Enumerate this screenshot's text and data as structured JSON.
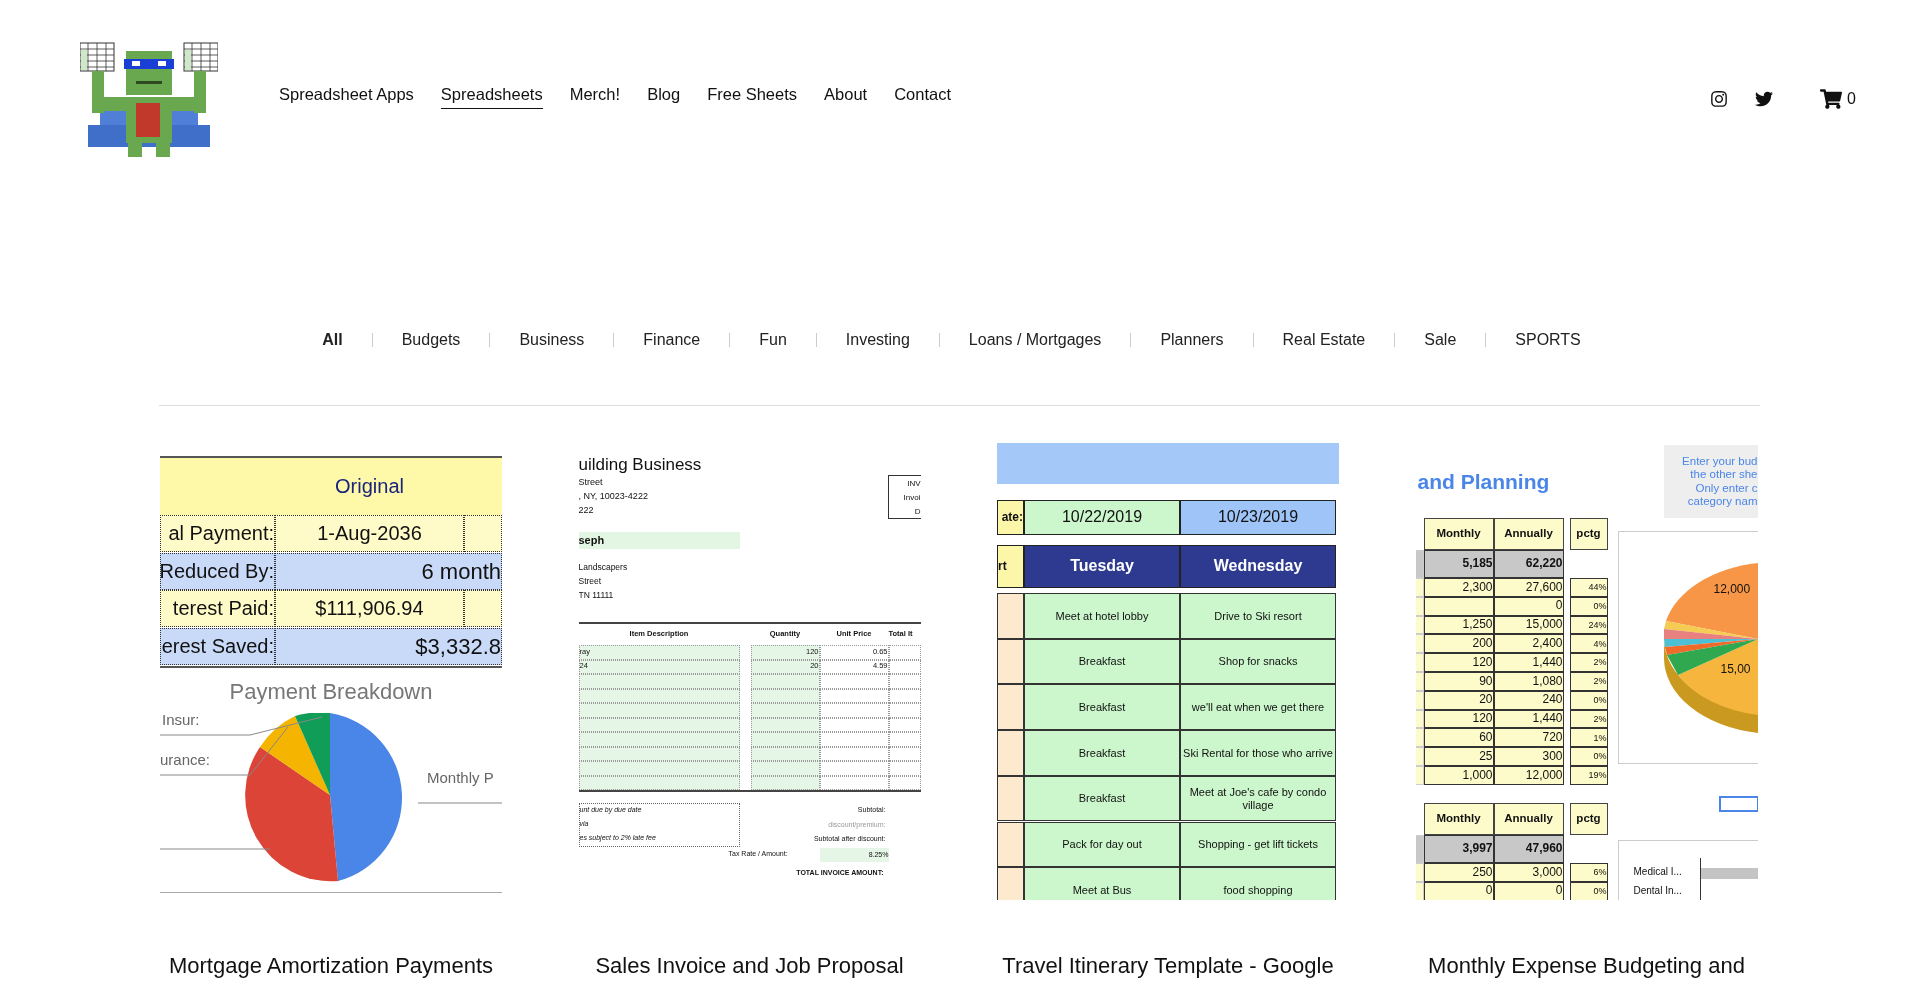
{
  "nav": {
    "items": [
      {
        "label": "Spreadsheet Apps",
        "selected": false
      },
      {
        "label": "Spreadsheets",
        "selected": true
      },
      {
        "label": "Merch!",
        "selected": false
      },
      {
        "label": "Blog",
        "selected": false
      },
      {
        "label": "Free Sheets",
        "selected": false
      },
      {
        "label": "About",
        "selected": false
      },
      {
        "label": "Contact",
        "selected": false
      }
    ],
    "cart_count": "0"
  },
  "filters": [
    {
      "label": "All",
      "selected": true
    },
    {
      "label": "Budgets",
      "selected": false
    },
    {
      "label": "Business",
      "selected": false
    },
    {
      "label": "Finance",
      "selected": false
    },
    {
      "label": "Fun",
      "selected": false
    },
    {
      "label": "Investing",
      "selected": false
    },
    {
      "label": "Loans / Mortgages",
      "selected": false
    },
    {
      "label": "Planners",
      "selected": false
    },
    {
      "label": "Real Estate",
      "selected": false
    },
    {
      "label": "Sale",
      "selected": false
    },
    {
      "label": "SPORTS",
      "selected": false
    }
  ],
  "products": [
    {
      "kind": "amortization",
      "title_lines": [
        "Mortgage Amortization Payments"
      ],
      "preview": {
        "header": "Original",
        "rows": [
          {
            "label": "al Payment:",
            "value": "1-Aug-2036",
            "merged": false
          },
          {
            "label": "Reduced By:",
            "value": "6 month",
            "merged": true
          },
          {
            "label": "terest Paid:",
            "value": "$111,906.94",
            "merged": false
          },
          {
            "label": "erest Saved:",
            "value": "$3,332.8",
            "merged": true
          }
        ],
        "chart_title": "Payment Breakdown",
        "chart_labels": [
          "Insur:",
          "urance:",
          "Monthly P"
        ]
      }
    },
    {
      "kind": "invoice",
      "title_lines": [
        "Sales Invoice and Job Proposal"
      ],
      "preview": {
        "company": "uilding Business",
        "address": [
          "Street",
          ", NY, 10023-4222",
          "222"
        ],
        "box_labels": [
          "INV",
          "Invoi",
          "D"
        ],
        "client": "seph",
        "client_lines": [
          "Landscapers",
          "Street",
          "TN  11111"
        ],
        "columns": [
          "Item Description",
          "Quantity",
          "Unit Price",
          "Total It"
        ],
        "rows": [
          [
            "ray",
            "120",
            "0.65"
          ],
          [
            "24",
            "20",
            "4.59"
          ]
        ],
        "notes": [
          "unt due by due date",
          "via",
          "es subject to 2% late fee"
        ],
        "totals": [
          "Subtotal:",
          "discount/premium:",
          "Subtotal after discount:"
        ],
        "tax_label": "Tax Rate / Amount:",
        "tax_rate": "8.25%",
        "total_label": "TOTAL INVOICE AMOUNT:"
      }
    },
    {
      "kind": "itinerary",
      "title_lines": [
        "Travel Itinerary Template - Google"
      ],
      "preview": {
        "date_label": "ate:",
        "dates": [
          "10/22/2019",
          "10/23/2019"
        ],
        "start_label": "rt",
        "days": [
          "Tuesday",
          "Wednesday"
        ],
        "rows": [
          [
            "Meet at hotel lobby",
            "Drive to Ski resort"
          ],
          [
            "Breakfast",
            "Shop for snacks"
          ],
          [
            "Breakfast",
            "we'll eat when we get there"
          ],
          [
            "Breakfast",
            "Ski Rental for those who arrive"
          ],
          [
            "Breakfast",
            "Meet at Joe's cafe by condo village"
          ],
          [
            "Pack for day out",
            "Shopping - get lift tickets"
          ],
          [
            "Meet at Bus",
            "food shopping"
          ]
        ]
      }
    },
    {
      "kind": "budget",
      "title_lines": [
        "Monthly Expense Budgeting and"
      ],
      "preview": {
        "title": "and Planning",
        "note": [
          "Enter your bud",
          "the other she",
          "Only enter c",
          "category nam"
        ],
        "tables": [
          {
            "headers": [
              "Monthly",
              "Annually",
              "pctg"
            ],
            "total": [
              "5,185",
              "62,220"
            ],
            "rows": [
              [
                "2,300",
                "27,600",
                "44%"
              ],
              [
                "",
                "0",
                "0%"
              ],
              [
                "1,250",
                "15,000",
                "24%"
              ],
              [
                "200",
                "2,400",
                "4%"
              ],
              [
                "120",
                "1,440",
                "2%"
              ],
              [
                "90",
                "1,080",
                "2%"
              ],
              [
                "20",
                "240",
                "0%"
              ],
              [
                "120",
                "1,440",
                "2%"
              ],
              [
                "60",
                "720",
                "1%"
              ],
              [
                "25",
                "300",
                "0%"
              ],
              [
                "1,000",
                "12,000",
                "19%"
              ]
            ]
          },
          {
            "headers": [
              "Monthly",
              "Annually",
              "pctg"
            ],
            "total": [
              "3,997",
              "47,960"
            ],
            "rows": [
              [
                "250",
                "3,000",
                "6%"
              ],
              [
                "0",
                "0",
                "0%"
              ]
            ]
          }
        ],
        "pie_labels": [
          "12,000",
          "15,00"
        ],
        "bar_labels": [
          "Medical I...",
          "Dental In..."
        ]
      }
    }
  ]
}
